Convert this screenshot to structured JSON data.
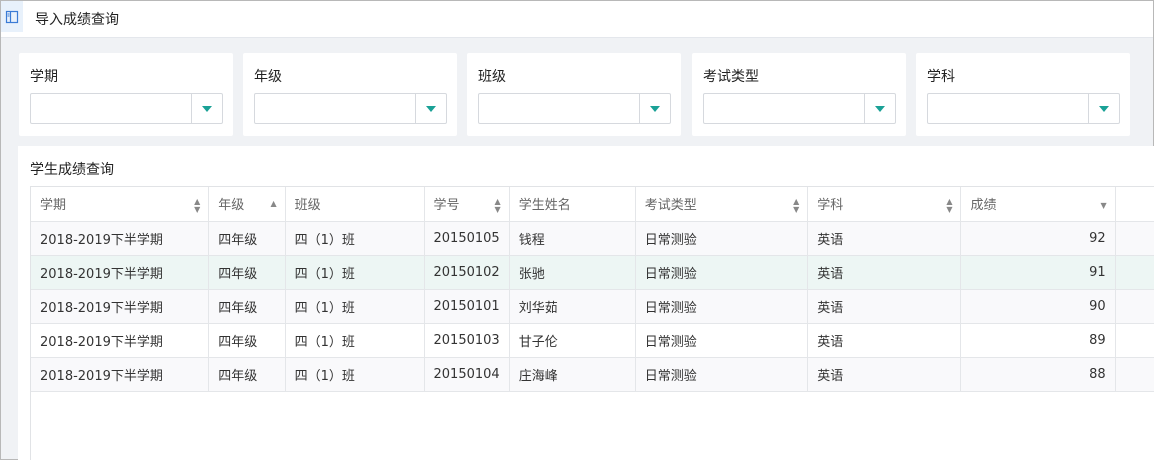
{
  "header": {
    "title": "导入成绩查询",
    "sidebar_toggle_icon": "sidebar-toggle-icon"
  },
  "filters": [
    {
      "label": "学期",
      "value": ""
    },
    {
      "label": "年级",
      "value": ""
    },
    {
      "label": "班级",
      "value": ""
    },
    {
      "label": "考试类型",
      "value": ""
    },
    {
      "label": "学科",
      "value": ""
    }
  ],
  "results": {
    "title": "学生成绩查询",
    "columns": [
      "学期",
      "年级",
      "班级",
      "学号",
      "学生姓名",
      "考试类型",
      "学科",
      "成绩"
    ],
    "column_sort": [
      "both",
      "asc",
      "none",
      "both",
      "none",
      "both",
      "both",
      "desc"
    ],
    "rows": [
      [
        "2018-2019下半学期",
        "四年级",
        "四（1）班",
        "20150105",
        "钱程",
        "日常测验",
        "英语",
        "92"
      ],
      [
        "2018-2019下半学期",
        "四年级",
        "四（1）班",
        "20150102",
        "张驰",
        "日常测验",
        "英语",
        "91"
      ],
      [
        "2018-2019下半学期",
        "四年级",
        "四（1）班",
        "20150101",
        "刘华茹",
        "日常测验",
        "英语",
        "90"
      ],
      [
        "2018-2019下半学期",
        "四年级",
        "四（1）班",
        "20150103",
        "甘子伦",
        "日常测验",
        "英语",
        "89"
      ],
      [
        "2018-2019下半学期",
        "四年级",
        "四（1）班",
        "20150104",
        "庄海峰",
        "日常测验",
        "英语",
        "88"
      ]
    ],
    "selected_row": 1
  },
  "colors": {
    "accent": "#1aa196",
    "selected_row": "#edf6f4",
    "page_bg": "#f0f2f5"
  }
}
